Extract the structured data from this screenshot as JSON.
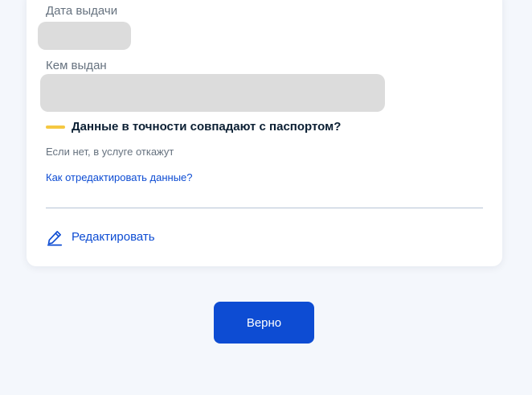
{
  "colors": {
    "background": "#f4f7fc",
    "card": "#ffffff",
    "primary": "#0d4cd3",
    "warning_accent": "#f5c842",
    "muted_text": "#66727f",
    "heading_text": "#0b1f33",
    "redacted_fill": "#dcdcdc"
  },
  "fields": {
    "issue_date": {
      "label": "Дата выдачи"
    },
    "issued_by": {
      "label": "Кем выдан"
    }
  },
  "warning": {
    "title": "Данные в точности совпадают с паспортом?",
    "hint": "Если нет, в услуге откажут",
    "link": "Как отредактировать данные?"
  },
  "actions": {
    "edit_label": "Редактировать",
    "edit_icon": "pencil-icon",
    "confirm_label": "Верно"
  }
}
